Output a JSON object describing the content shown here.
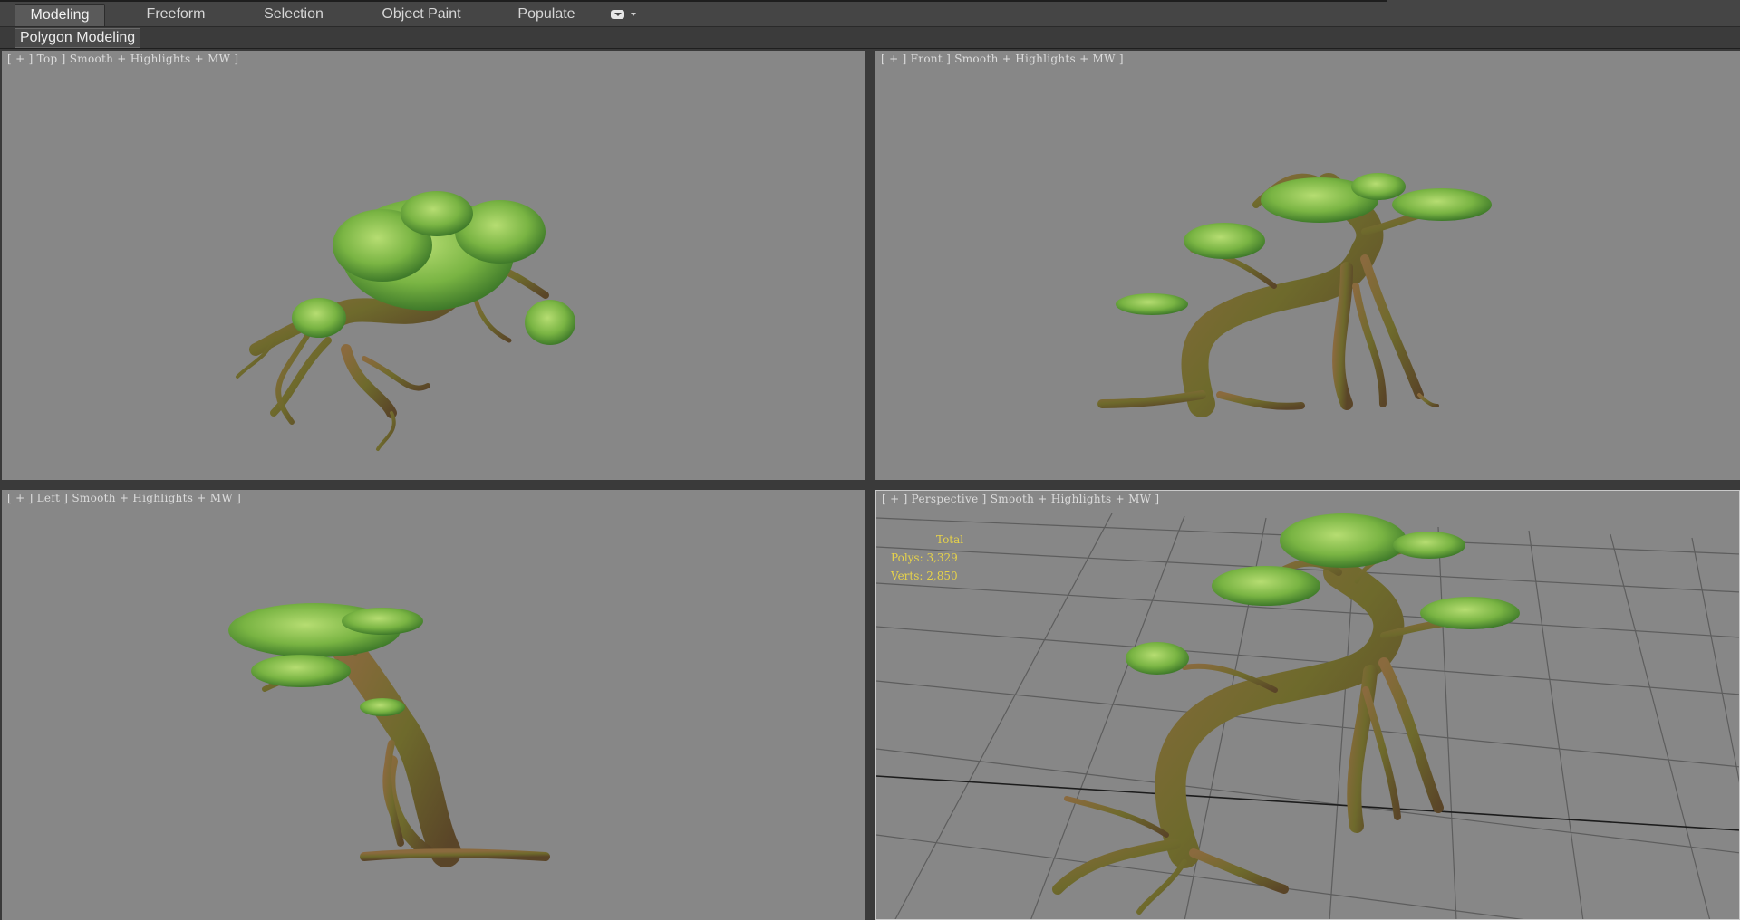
{
  "ribbon": {
    "tabs": [
      {
        "label": "Modeling",
        "active": true
      },
      {
        "label": "Freeform",
        "active": false
      },
      {
        "label": "Selection",
        "active": false
      },
      {
        "label": "Object Paint",
        "active": false
      },
      {
        "label": "Populate",
        "active": false
      }
    ],
    "panel_label": "Polygon Modeling"
  },
  "viewports": {
    "top": {
      "label": "[ + ] Top ] Smooth + Highlights + MW ]"
    },
    "front": {
      "label": "[ + ] Front ] Smooth + Highlights + MW ]"
    },
    "left": {
      "label": "[ + ] Left ] Smooth + Highlights + MW ]"
    },
    "perspective": {
      "label": "[ + ] Perspective ] Smooth + Highlights + MW ]"
    }
  },
  "stats": {
    "title": "Total",
    "polys": "Polys: 3,329",
    "verts": "Verts: 2,850"
  },
  "colors": {
    "viewport_bg": "#878787",
    "stats_text": "#e6d24a",
    "trunk": "#6b5a2e",
    "moss": "#8c8a2a",
    "foliage": "#6fae3c",
    "foliage_light": "#a8d267"
  }
}
